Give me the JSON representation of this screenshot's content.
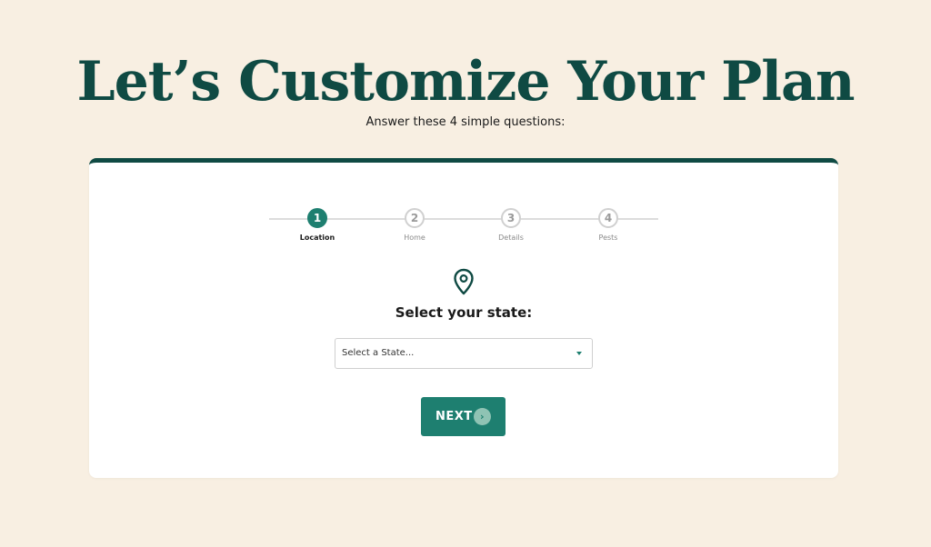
{
  "header": {
    "title": "Let’s Customize Your Plan",
    "subtitle": "Answer these 4 simple questions:"
  },
  "stepper": {
    "current_step": 1,
    "steps": [
      {
        "number": "1",
        "label": "Location"
      },
      {
        "number": "2",
        "label": "Home"
      },
      {
        "number": "3",
        "label": "Details"
      },
      {
        "number": "4",
        "label": "Pests"
      }
    ]
  },
  "form": {
    "icon": "map-pin-icon",
    "question": "Select your state:",
    "state_select": {
      "value": "Select a State..."
    },
    "next_label": "NEXT",
    "next_icon": "chevron-right-icon",
    "next_arrow_glyph": "›"
  },
  "colors": {
    "background": "#f8efe2",
    "brand_dark": "#0f4a43",
    "accent": "#1e7f70",
    "card": "#ffffff"
  }
}
